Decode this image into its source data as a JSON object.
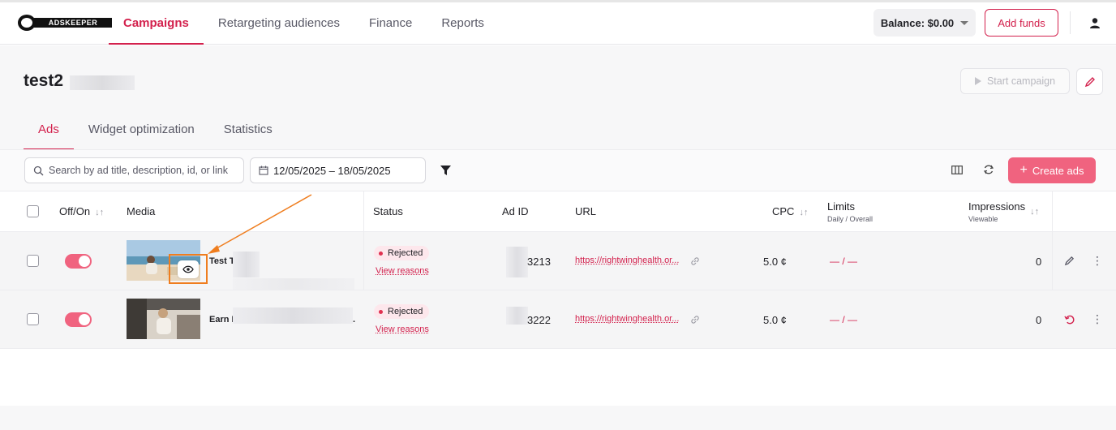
{
  "app": {
    "logo_text": "ADSKEEPER"
  },
  "nav": {
    "items": [
      "Campaigns",
      "Retargeting audiences",
      "Finance",
      "Reports"
    ]
  },
  "header": {
    "balance": "Balance: $0.00",
    "add_funds": "Add funds"
  },
  "campaign": {
    "title": "test2",
    "start_label": "Start campaign"
  },
  "tabs": [
    "Ads",
    "Widget optimization",
    "Statistics"
  ],
  "toolbar": {
    "search_placeholder": "Search by ad title, description, id, or link",
    "date_range": "12/05/2025 – 18/05/2025",
    "create_label": "Create ads"
  },
  "table": {
    "headers": {
      "offon": "Off/On",
      "media": "Media",
      "status": "Status",
      "adid": "Ad ID",
      "url": "URL",
      "cpc": "CPC",
      "limits": "Limits",
      "limits_sub": "Daily / Overall",
      "impressions": "Impressions",
      "impressions_sub": "Viewable",
      "sort_glyph": "↓↑"
    },
    "rows": [
      {
        "title": "Test T",
        "status": "Rejected",
        "view_reasons": "View reasons",
        "ad_id": "3213",
        "url": "https://rightwinghealth.or...",
        "cpc": "5.0 ¢",
        "limits": "— / —",
        "impressions": "0"
      },
      {
        "title": "Earn M",
        "title_tail": ".",
        "status": "Rejected",
        "view_reasons": "View reasons",
        "ad_id": "3222",
        "url": "https://rightwinghealth.or...",
        "cpc": "5.0 ¢",
        "limits": "— / —",
        "impressions": "0"
      }
    ]
  },
  "colors": {
    "accent": "#d3214d",
    "toggle": "#f0637f",
    "annotation": "#ef7d1e"
  }
}
